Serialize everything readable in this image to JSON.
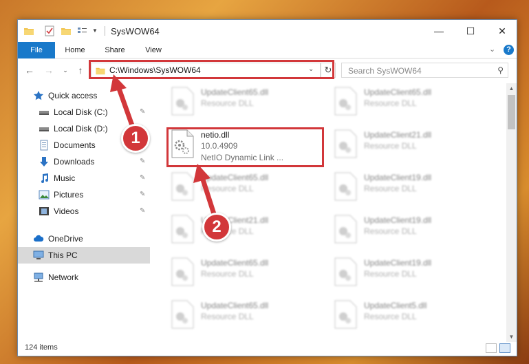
{
  "window": {
    "title": "SysWOW64",
    "controls": {
      "minimize": "—",
      "maximize": "☐",
      "close": "✕"
    }
  },
  "ribbon": {
    "tabs": [
      "File",
      "Home",
      "Share",
      "View"
    ],
    "help": "?"
  },
  "nav": {
    "path": "C:\\Windows\\SysWOW64",
    "search_placeholder": "Search SysWOW64"
  },
  "sidebar": {
    "items": [
      {
        "label": "Quick access",
        "icon": "star-icon",
        "pinned": false
      },
      {
        "label": "Local Disk (C:)",
        "icon": "drive-icon",
        "pinned": true
      },
      {
        "label": "Local Disk (D:)",
        "icon": "drive-icon",
        "pinned": true
      },
      {
        "label": "Documents",
        "icon": "documents-icon",
        "pinned": true
      },
      {
        "label": "Downloads",
        "icon": "downloads-icon",
        "pinned": true
      },
      {
        "label": "Music",
        "icon": "music-icon",
        "pinned": true
      },
      {
        "label": "Pictures",
        "icon": "pictures-icon",
        "pinned": true
      },
      {
        "label": "Videos",
        "icon": "videos-icon",
        "pinned": true
      },
      {
        "label": "OneDrive",
        "icon": "onedrive-icon",
        "pinned": false
      },
      {
        "label": "This PC",
        "icon": "pc-icon",
        "pinned": false,
        "selected": true
      },
      {
        "label": "Network",
        "icon": "network-icon",
        "pinned": false
      }
    ]
  },
  "files": {
    "left_column": [
      {
        "name": "UpdateClient65.dll",
        "type": "Resource DLL"
      },
      {
        "name": "netio.dll",
        "version": "10.0.4909",
        "description": "NetIO Dynamic Link ..."
      },
      {
        "name": "UpdateClient65.dll",
        "type": "Resource DLL"
      },
      {
        "name": "UpdateClient21.dll",
        "type": "Resource DLL"
      },
      {
        "name": "UpdateClient65.dll",
        "type": "Resource DLL"
      },
      {
        "name": "UpdateClient65.dll",
        "type": "Resource DLL"
      }
    ],
    "right_column": [
      {
        "name": "UpdateClient65.dll",
        "type": "Resource DLL"
      },
      {
        "name": "UpdateClient21.dll",
        "type": "Resource DLL"
      },
      {
        "name": "UpdateClient19.dll",
        "type": "Resource DLL"
      },
      {
        "name": "UpdateClient19.dll",
        "type": "Resource DLL"
      },
      {
        "name": "UpdateClient19.dll",
        "type": "Resource DLL"
      },
      {
        "name": "UpdateClient5.dll",
        "type": "Resource DLL"
      }
    ]
  },
  "status": {
    "item_count": "124 items"
  },
  "steps": [
    "1",
    "2"
  ],
  "colors": {
    "accent": "#1979ca",
    "highlight": "#d2373a"
  }
}
